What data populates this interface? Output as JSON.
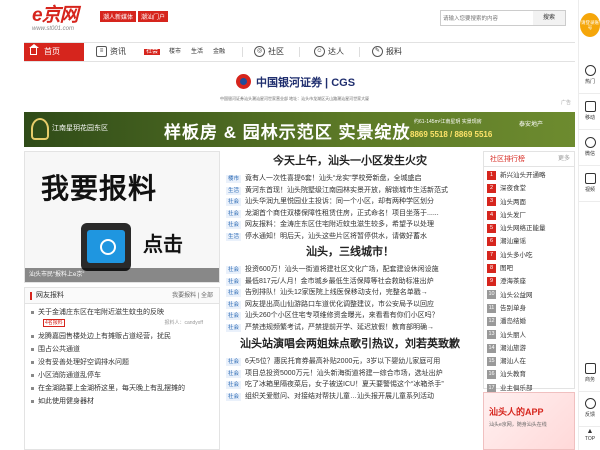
{
  "header": {
    "logo_main": "e京网",
    "logo_url": "www.st001.com",
    "slogan_1": "潮人新媒体",
    "slogan_2": "潮汕门户",
    "search_placeholder": "请输入您要搜索的内容",
    "search_button": "搜索"
  },
  "nav": {
    "home": "首页",
    "info": "资讯",
    "info_tag": "社会",
    "sub1": "楼市",
    "sub2": "生活",
    "sub3": "金融",
    "community": "社区",
    "talent": "达人",
    "report": "报料"
  },
  "banner1": {
    "name": "中国银河证券 | CGS",
    "sub": "中国银河证券汕头潮汕星河世家营业部    地址：汕头市龙湖区天山路潮汕星河世家大厦",
    "ad": "广告"
  },
  "banner2": {
    "small": "江南星玥花园东区",
    "big": "样板房 & 园林示范区 实景绽放",
    "price": "约61-145m²江南星玥 实景现房",
    "phone": "8869 5518 / 8869 5516",
    "developer": "泰安地产"
  },
  "feature": {
    "big": "我要报料",
    "click": "点击",
    "caption": "汕头市民“报料上e京”"
  },
  "left_box": {
    "title": "网友报料",
    "right": "我要报料 | 全部",
    "items": [
      "关于金浦庄东区在宅附近滋生蚊虫的反映",
      "龙腾嘉园售楼处边上有摊贩占道经营，扰民",
      "围占公共通道",
      "没有妥善处理好空调排水问题",
      "小区消防通道乱停车",
      "在金湖路要上金湖桥这里，每天晚上有乱摆摊的",
      "如此使用健身器材"
    ],
    "meta_tag": "4名报料",
    "meta_author": "报料人：candyxff"
  },
  "center": {
    "headline1": "今天上午，汕头一小区发生火灾",
    "list1": [
      {
        "tag": "楼市",
        "text": "竟有人一次性喜提6套！汕头“龙实”学校旁新盘，全城盛启"
      },
      {
        "tag": "生活",
        "text": "黄河东首现！汕头院墅级江南园林实景开放，解锁城市生活新范式"
      },
      {
        "tag": "社会",
        "text": "汕头华润九里悦园业主投诉：同一个小区，却有两种学区划分"
      },
      {
        "tag": "社会",
        "text": "龙湖首个商住双楼保障性租赁住房，正式命名！项目坐落于......"
      },
      {
        "tag": "社会",
        "text": "网友报料：金涛庄东区住宅附近蚊虫滋生较多，希望予以处理"
      },
      {
        "tag": "生活",
        "text": "停水通知！明后天，汕头这些片区将暂停供水，请做好蓄水"
      }
    ],
    "headline2": "汕头，三线城市！",
    "list2": [
      {
        "tag": "社会",
        "text": "投资600万！汕头一街道将建社区文化广场，配套建设休闲设施"
      },
      {
        "tag": "社会",
        "text": "最低817元/人月！金市城乡最低生活保障等社会救助标准出炉"
      },
      {
        "tag": "社会",
        "text": "告别排队！汕头12家医院上线医保移动支付，完整名单戳→"
      },
      {
        "tag": "社会",
        "text": "网友提出高山仙游路口车道优化调整建议，市公安局予以回应"
      },
      {
        "tag": "社会",
        "text": "汕头260个小区住宅专项维修资金曝光，来看看有你们小区吗？"
      },
      {
        "tag": "社会",
        "text": "严禁违规频繁考试，严禁提前开学、延迟放假！教育部明确→"
      }
    ],
    "headline3": "汕头站演唱会两姐妹点歌引热议，刘若英致歉",
    "list3": [
      {
        "tag": "社会",
        "text": "6天5位？惠民托育券最高补贴2000元，3岁以下婴幼儿家庭可用"
      },
      {
        "tag": "社会",
        "text": "项目总投资5000万元！汕头新海街道将建一综合市场，选址出炉"
      },
      {
        "tag": "社会",
        "text": "吃了冰箱里隔夜菜后，女子被送ICU！夏天要警惕这个“冰箱杀手”"
      },
      {
        "tag": "社会",
        "text": "组织关爱慰问、对接结对帮扶儿童…汕头报开展儿童系列活动"
      }
    ]
  },
  "right": {
    "title": "社区排行榜",
    "more": "更多",
    "items": [
      "新兴汕头开通略",
      "深夜食堂",
      "汕头两面",
      "汕头发厂",
      "汕头网络正能量",
      "潮汕童谣",
      "汕头多小吃",
      "图吧",
      "澄海茶座",
      "汕头公益网",
      "告别单身",
      "潘岛结婚",
      "汕头丽人",
      "潮汕旅游",
      "潮汕人在",
      "汕头教育",
      "业主俱乐部"
    ]
  },
  "app_ad": {
    "title": "汕头人的APP",
    "sub": "汕头e京网，随身汕头在线"
  },
  "sidebar": {
    "top_badge": "请登录账号",
    "items": [
      "热门",
      "移动",
      "微信",
      "视频",
      "商务",
      "反馈",
      "TOP"
    ]
  }
}
